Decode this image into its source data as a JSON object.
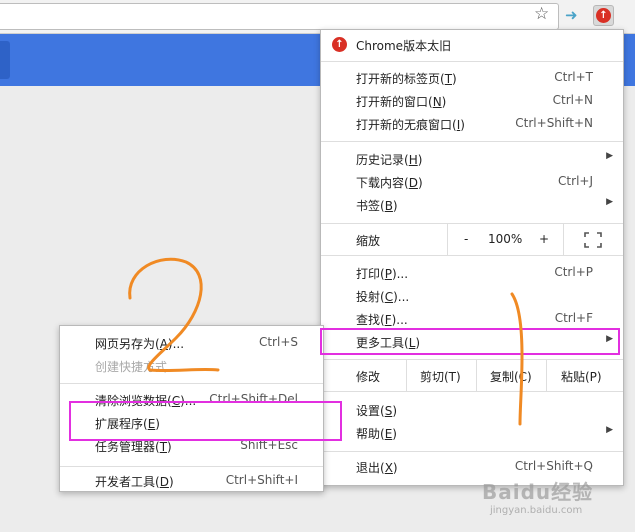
{
  "browser": {
    "star_icon": "star-icon",
    "extension_icon": "extension-icon",
    "menu_badge_glyph": "↑"
  },
  "main_menu": {
    "update_label": "Chrome版本太旧",
    "items_top": [
      {
        "label": "打开新的标签页(",
        "key": "T",
        "suffix": ")",
        "shortcut": "Ctrl+T"
      },
      {
        "label": "打开新的窗口(",
        "key": "N",
        "suffix": ")",
        "shortcut": "Ctrl+N"
      },
      {
        "label": "打开新的无痕窗口(",
        "key": "I",
        "suffix": ")",
        "shortcut": "Ctrl+Shift+N"
      }
    ],
    "items_history": [
      {
        "label": "历史记录(",
        "key": "H",
        "suffix": ")",
        "shortcut": ""
      },
      {
        "label": "下载内容(",
        "key": "D",
        "suffix": ")",
        "shortcut": "Ctrl+J"
      },
      {
        "label": "书签(",
        "key": "B",
        "suffix": ")",
        "shortcut": ""
      }
    ],
    "zoom": {
      "label": "缩放",
      "minus": "-",
      "value": "100%",
      "plus": "+"
    },
    "items_print": [
      {
        "label": "打印(",
        "key": "P",
        "suffix": ")...",
        "shortcut": "Ctrl+P"
      },
      {
        "label": "投射(",
        "key": "C",
        "suffix": ")...",
        "shortcut": ""
      },
      {
        "label": "查找(",
        "key": "F",
        "suffix": ")...",
        "shortcut": "Ctrl+F"
      }
    ],
    "more_tools": {
      "label": "更多工具(",
      "key": "L",
      "suffix": ")"
    },
    "edit": {
      "label": "修改",
      "cut": "剪切(T)",
      "copy": "复制(C)",
      "paste": "粘贴(P)"
    },
    "items_settings": [
      {
        "label": "设置(",
        "key": "S",
        "suffix": ")"
      },
      {
        "label": "帮助(",
        "key": "E",
        "suffix": ")"
      }
    ],
    "exit": {
      "label": "退出(",
      "key": "X",
      "suffix": ")",
      "shortcut": "Ctrl+Shift+Q"
    }
  },
  "sub_menu": {
    "items": [
      {
        "label": "网页另存为(",
        "key": "A",
        "suffix": ")...",
        "shortcut": "Ctrl+S",
        "disabled": false
      },
      {
        "label": "创建快捷方式...",
        "key": "",
        "suffix": "",
        "shortcut": "",
        "disabled": true
      },
      {
        "label": "清除浏览数据(",
        "key": "C",
        "suffix": ")...",
        "shortcut": "Ctrl+Shift+Del",
        "disabled": false
      },
      {
        "label": "扩展程序(",
        "key": "E",
        "suffix": ")",
        "shortcut": "",
        "disabled": false
      },
      {
        "label": "任务管理器(",
        "key": "T",
        "suffix": ")",
        "shortcut": "Shift+Esc",
        "disabled": false
      },
      {
        "label": "开发者工具(",
        "key": "D",
        "suffix": ")",
        "shortcut": "Ctrl+Shift+I",
        "disabled": false
      }
    ]
  },
  "watermark": {
    "brand": "Baidu经验",
    "url": "jingyan.baidu.com"
  },
  "annotations": {
    "step_number": "2",
    "step_marker": "1"
  },
  "colors": {
    "highlight": "#e22fe0",
    "annotation": "#f08a24",
    "update_red": "#d93025",
    "banner_blue": "#3f76e0"
  }
}
